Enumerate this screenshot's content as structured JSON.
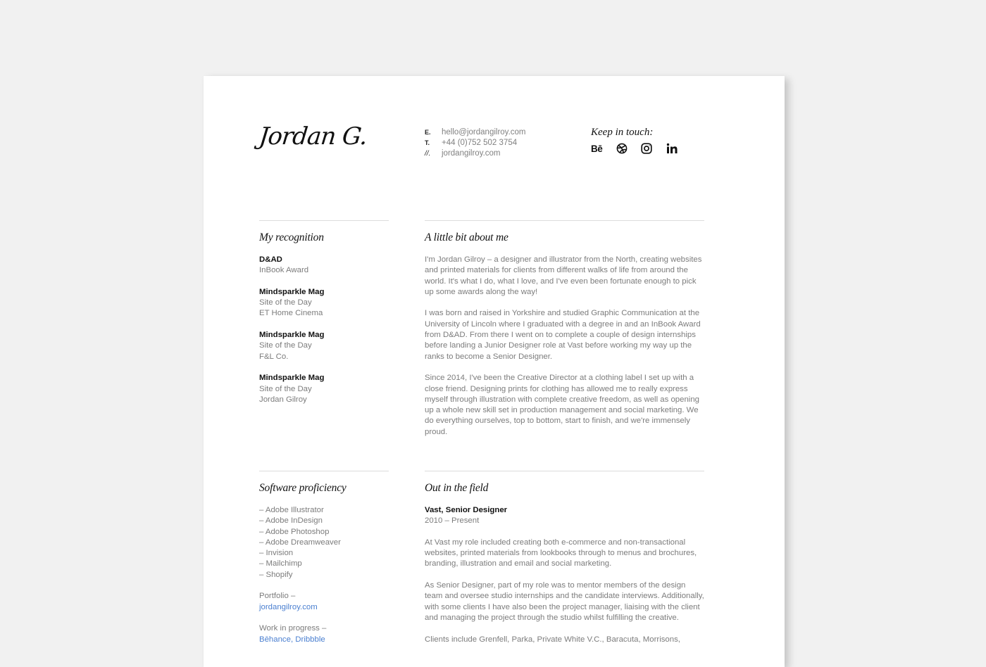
{
  "header": {
    "logo_text": "Jordan G.",
    "contact": [
      {
        "key": "E.",
        "value": "hello@jordangilroy.com"
      },
      {
        "key": "T.",
        "value": "+44 (0)752 502 3754"
      },
      {
        "key": "//.",
        "value": "jordangilroy.com"
      }
    ],
    "keep_in_touch": {
      "title": "Keep in touch:",
      "icons": [
        "behance-icon",
        "dribbble-icon",
        "instagram-icon",
        "linkedin-icon"
      ],
      "behance_label": "Bē"
    }
  },
  "recognition": {
    "title": "My recognition",
    "items": [
      {
        "org": "D&AD",
        "lines": [
          "InBook Award"
        ]
      },
      {
        "org": "Mindsparkle Mag",
        "lines": [
          "Site of the Day",
          "ET Home Cinema"
        ]
      },
      {
        "org": "Mindsparkle Mag",
        "lines": [
          "Site of the Day",
          "F&L Co."
        ]
      },
      {
        "org": "Mindsparkle Mag",
        "lines": [
          "Site of the Day",
          "Jordan Gilroy"
        ]
      }
    ]
  },
  "about": {
    "title": "A little bit about me",
    "paragraphs": [
      "I'm Jordan Gilroy – a designer and illustrator from the North, creating websites and printed materials for clients from different walks of life from around the world. It's what I do, what I love, and I've even been fortunate enough to pick up some awards along the way!",
      "I was born and raised in Yorkshire and studied Graphic Communication at the University of Lincoln where I graduated with a degree in and an InBook Award from D&AD. From there I went on to complete a couple of design internships before landing a Junior Designer role at Vast before working my way up the ranks to become a Senior Designer.",
      "Since 2014, I've been the Creative Director at a clothing label I set up with a close friend. Designing prints for clothing has allowed me to really express myself through illustration with complete creative freedom, as well as opening up a whole new skill set in production management and social marketing. We do everything ourselves, top to bottom, start to finish, and we're immensely proud."
    ]
  },
  "software": {
    "title": "Software proficiency",
    "items": [
      "– Adobe Illustrator",
      "– Adobe InDesign",
      "– Adobe Photoshop",
      "– Adobe Dreamweaver",
      "– Invision",
      "– Mailchimp",
      "– Shopify"
    ],
    "portfolio_label": "Portfolio –",
    "portfolio_link": "jordangilroy.com",
    "wip_label": "Work in progress –",
    "wip_links": "Bēhance, Dribbble"
  },
  "experience": {
    "title": "Out in the field",
    "role": "Vast, Senior Designer",
    "period": "2010 – Present",
    "paragraphs": [
      "At Vast my role included creating both e-commerce and non-transactional websites, printed materials from lookbooks through to menus and brochures, branding, illustration and email and social marketing.",
      "As Senior Designer, part of my role was to mentor members of the design team and oversee studio internships and the candidate interviews. Additionally, with some clients I have also been the project manager, liaising with the client and managing the project through the studio whilst fulfilling the creative.",
      "Clients include Grenfell, Parka, Private White V.C., Baracuta, Morrisons,"
    ]
  },
  "colors": {
    "background": "#f1f1f1",
    "paper": "#ffffff",
    "text_heading": "#111111",
    "text_body": "#7c7c7c",
    "link": "#4a7fd0",
    "divider": "#dcdcdc"
  }
}
